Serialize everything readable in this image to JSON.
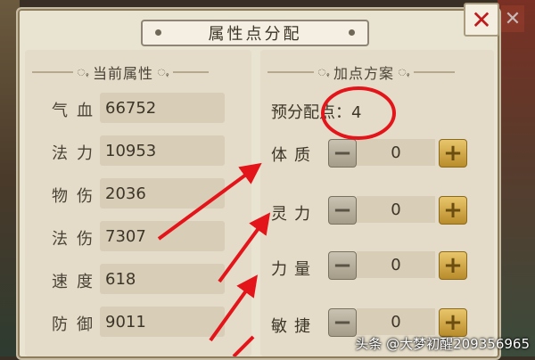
{
  "dialog": {
    "title": "属性点分配",
    "close_symbol": "✕"
  },
  "current_attributes": {
    "header": "当前属性",
    "stats": [
      {
        "label": "气血",
        "value": "66752"
      },
      {
        "label": "法力",
        "value": "10953"
      },
      {
        "label": "物伤",
        "value": "2036"
      },
      {
        "label": "法伤",
        "value": "7307"
      },
      {
        "label": "速度",
        "value": "618"
      },
      {
        "label": "防御",
        "value": "9011"
      }
    ]
  },
  "allocation": {
    "header": "加点方案",
    "pool_label": "预分配点：",
    "pool_value": "4",
    "rows": [
      {
        "label": "体质",
        "value": "0"
      },
      {
        "label": "灵力",
        "value": "0"
      },
      {
        "label": "力量",
        "value": "0"
      },
      {
        "label": "敏捷",
        "value": "0"
      }
    ],
    "minus_symbol": "−",
    "plus_symbol": "+"
  },
  "annotation_colors": {
    "arrow": "#e3141a",
    "circle": "#e3141a"
  },
  "watermark": "头条 @大梦初醒209356965"
}
